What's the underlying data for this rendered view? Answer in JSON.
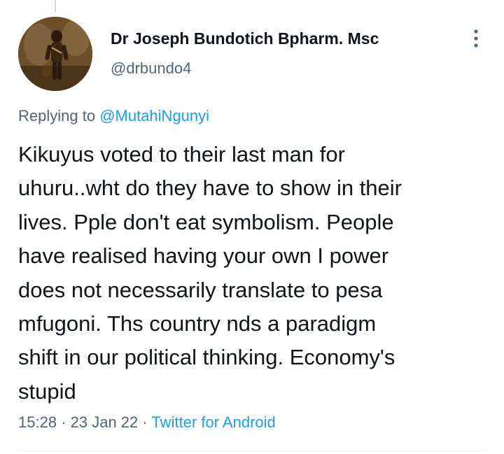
{
  "tweet": {
    "author_name": "Dr Joseph Bundotich Bpharm. Msc",
    "author_handle": "@drbundo4",
    "replying_prefix": "Replying to ",
    "replying_to": "@MutahiNgunyi",
    "text_lines": [
      "Kikuyus voted to their last man for",
      "uhuru..wht do they have to show in their",
      "lives. Pple don't eat symbolism. People",
      "have realised having your own I power",
      "does not necessarily translate to pesa",
      "mfugoni. Ths country nds a paradigm",
      "shift in our political thinking. Economy's",
      "stupid"
    ],
    "time": "15:28",
    "separator": "·",
    "date": "23 Jan 22",
    "source": "Twitter for Android"
  },
  "icons": {
    "more": "more-vertical-icon",
    "avatar": "profile-avatar-image"
  },
  "colors": {
    "link": "#1d9bf0",
    "secondary_text": "#536471",
    "primary_text": "#0f1419"
  }
}
